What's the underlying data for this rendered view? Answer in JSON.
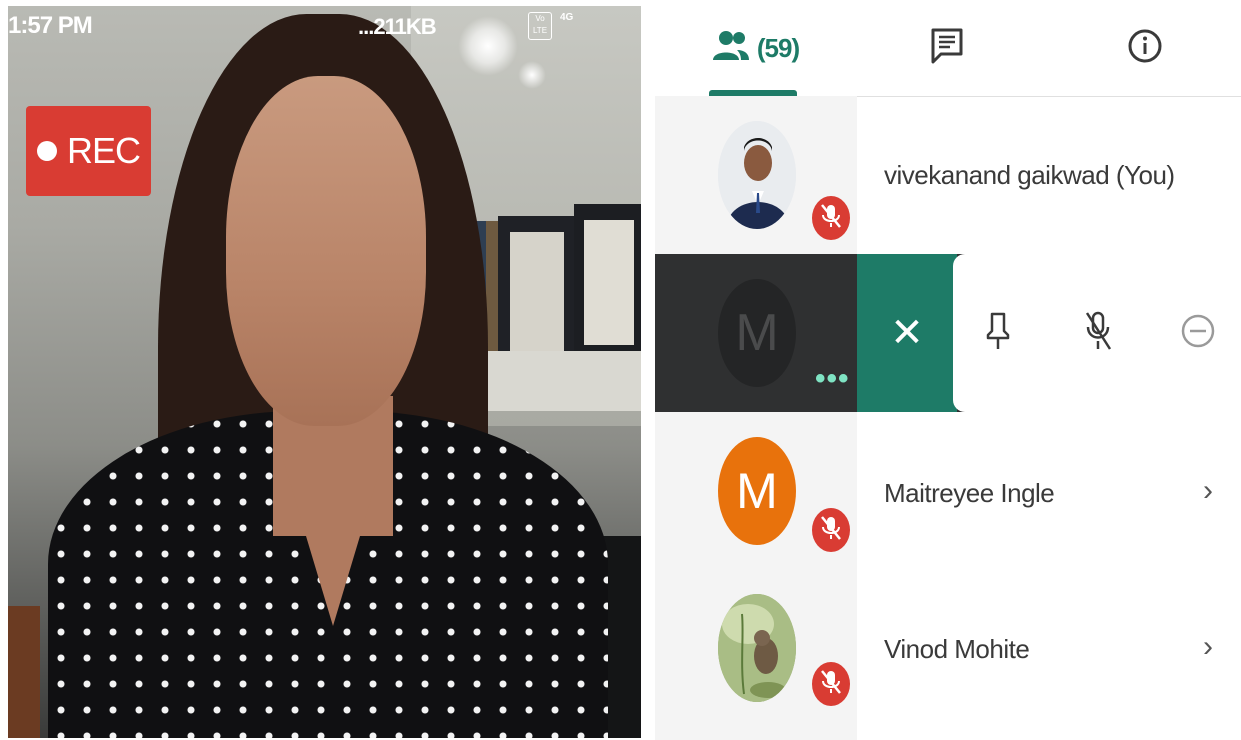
{
  "status_bar": {
    "time": "1:57 PM",
    "network_speed": "...211KB",
    "volte_label": "Vo LTE",
    "network_type": "4G"
  },
  "video": {
    "rec_label": "REC"
  },
  "tabs": {
    "people_count": "(59)",
    "people_icon": "people-icon",
    "chat_icon": "chat-icon",
    "info_icon": "info-icon"
  },
  "participants": [
    {
      "name": "vivekanand gaikwad (You)",
      "muted": true
    },
    {
      "avatar_letter": "M",
      "more_indicator": "•••",
      "close_label": "✕"
    },
    {
      "name": "Maitreyee Ingle",
      "avatar_letter": "M",
      "muted": true,
      "chevron": "›"
    },
    {
      "name": "Vinod Mohite",
      "muted": true,
      "chevron": "›"
    }
  ],
  "colors": {
    "accent": "#1e7b67",
    "rec_red": "#d93c33",
    "avatar_orange": "#e8720c"
  }
}
